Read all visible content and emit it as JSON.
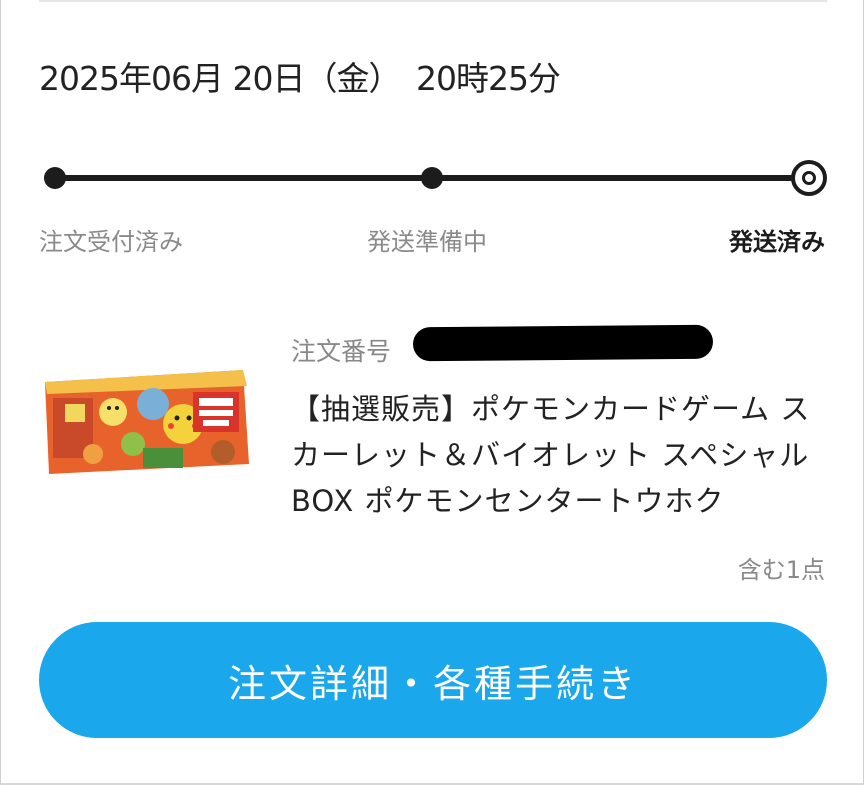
{
  "order": {
    "datetime": "2025年06月 20日（金）　20時25分",
    "order_number_label": "注文番号",
    "product_title": "【抽選販売】ポケモンカードゲーム スカーレット＆バイオレット スペシャルBOX ポケモンセンタートウホク",
    "item_count": "含む1点"
  },
  "progress": {
    "steps": [
      {
        "label": "注文受付済み",
        "state": "done"
      },
      {
        "label": "発送準備中",
        "state": "done"
      },
      {
        "label": "発送済み",
        "state": "current"
      }
    ]
  },
  "actions": {
    "detail_button_label": "注文詳細・各種手続き"
  },
  "colors": {
    "accent": "#1aa7ec",
    "track": "#1c1c1c",
    "muted_text": "#8a8a8a"
  }
}
